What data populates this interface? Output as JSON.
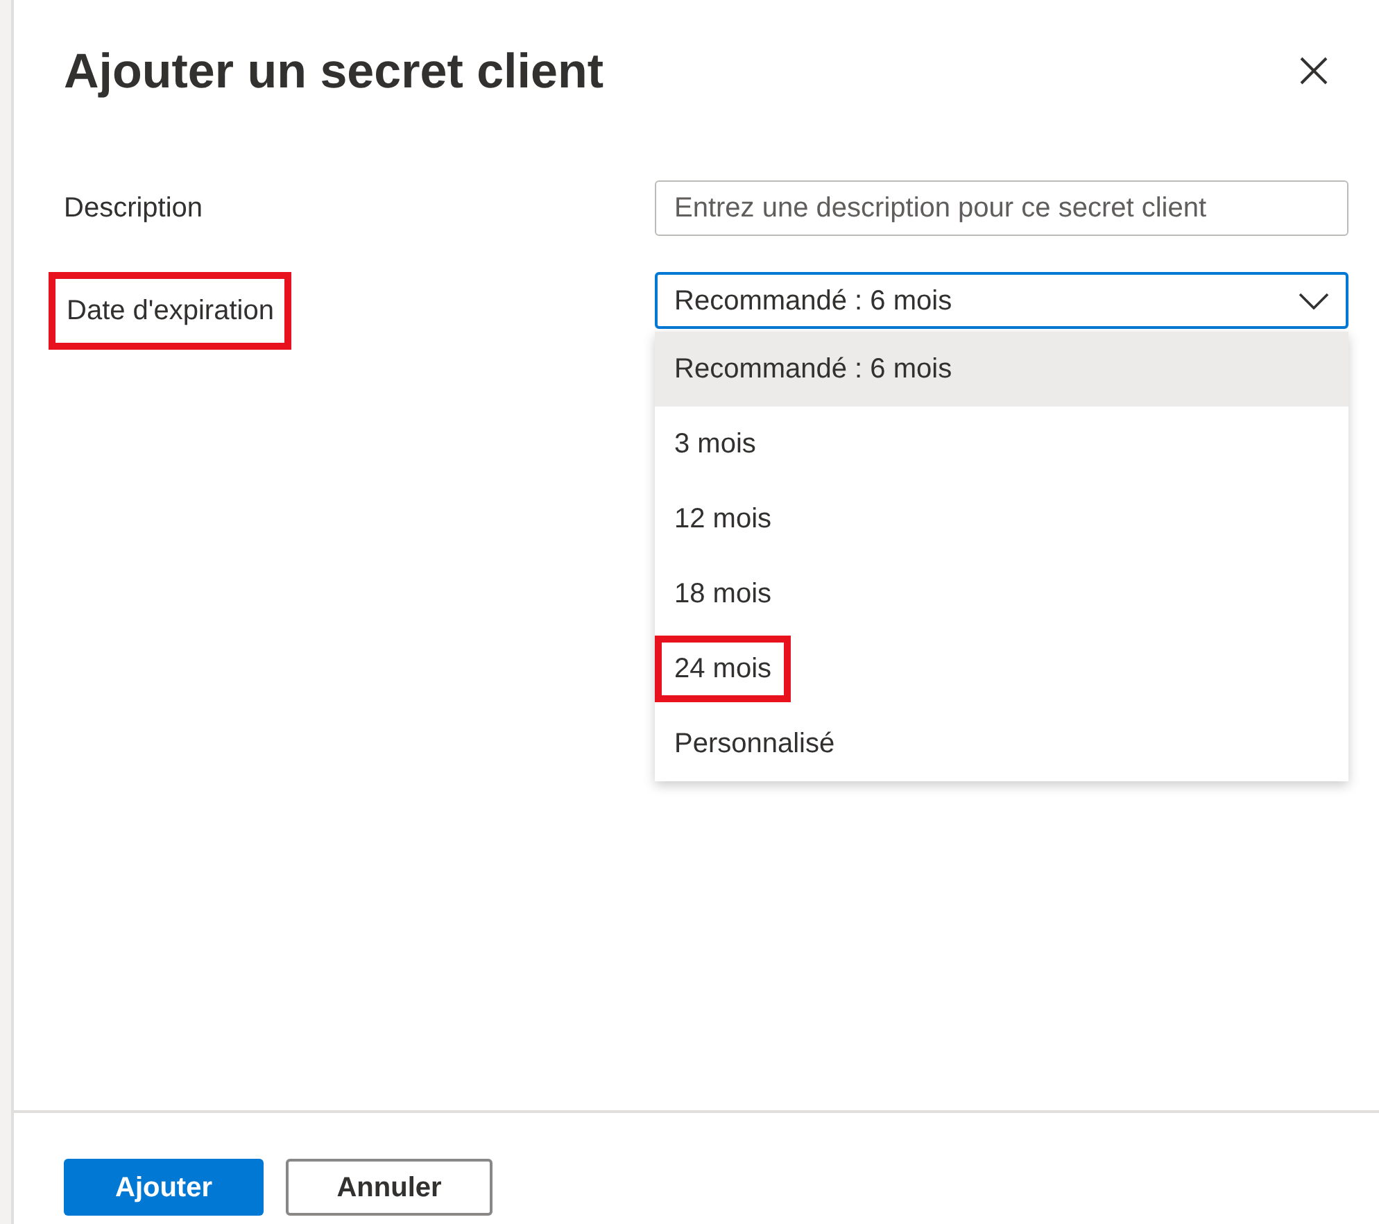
{
  "title": "Ajouter un secret client",
  "description": {
    "label": "Description",
    "placeholder": "Entrez une description pour ce secret client"
  },
  "expiration": {
    "label": "Date d'expiration",
    "highlighted": true,
    "value": "Recommandé : 6 mois",
    "expanded": true,
    "options": [
      {
        "label": "Recommandé : 6 mois",
        "selected": true,
        "highlighted": false
      },
      {
        "label": "3 mois",
        "selected": false,
        "highlighted": false
      },
      {
        "label": "12 mois",
        "selected": false,
        "highlighted": false
      },
      {
        "label": "18 mois",
        "selected": false,
        "highlighted": false
      },
      {
        "label": "24 mois",
        "selected": false,
        "highlighted": true
      },
      {
        "label": "Personnalisé",
        "selected": false,
        "highlighted": false
      }
    ]
  },
  "buttons": [
    {
      "label": "Ajouter",
      "kind": "primary"
    },
    {
      "label": "Annuler",
      "kind": "secondary"
    }
  ]
}
